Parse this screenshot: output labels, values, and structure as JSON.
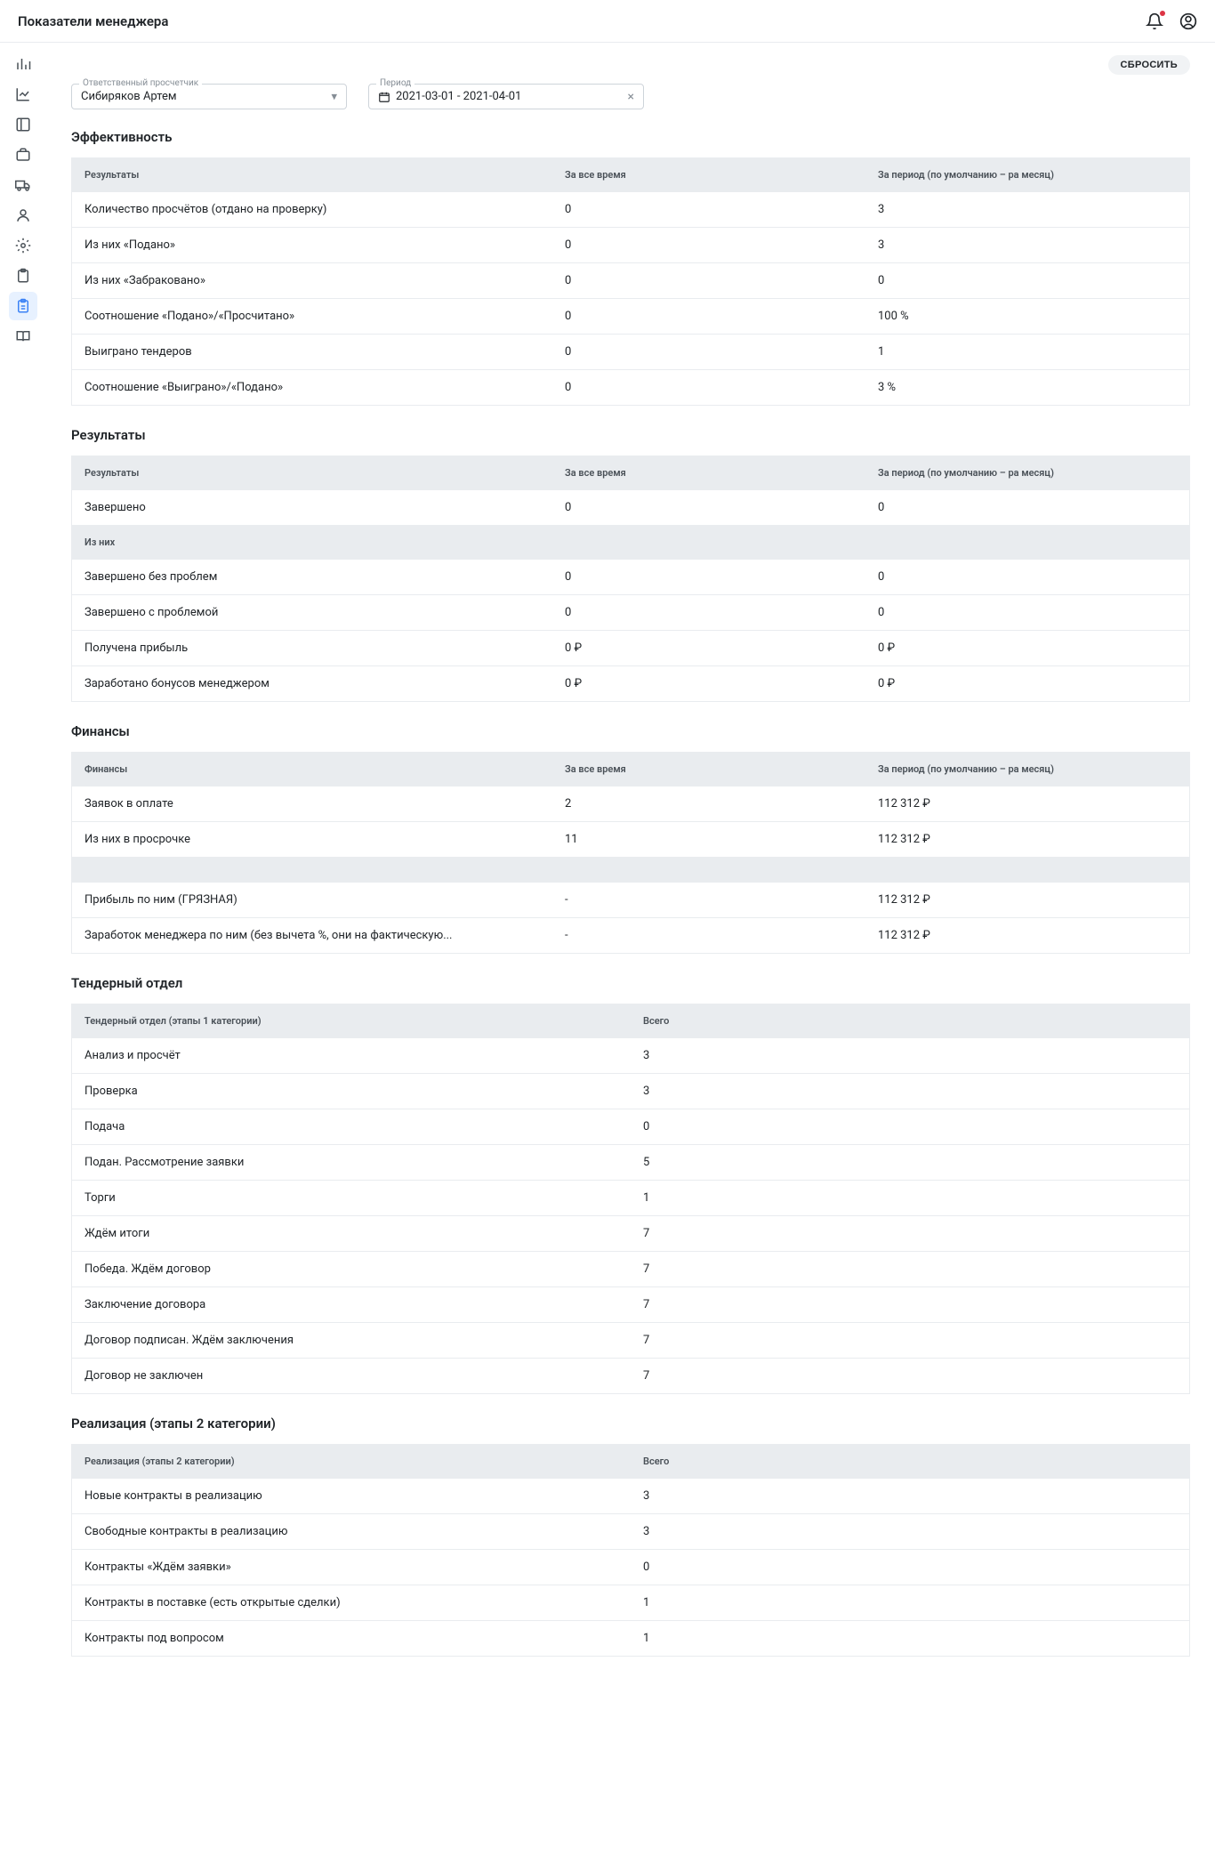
{
  "header": {
    "title": "Показатели менеджера"
  },
  "top": {
    "reset": "СБРОСИТЬ"
  },
  "filters": {
    "responsible": {
      "label": "Ответственный просчетчик",
      "value": "Сибиряков Артем"
    },
    "period": {
      "label": "Период",
      "value": "2021-03-01 - 2021-04-01"
    }
  },
  "cols3": {
    "results": "Результаты",
    "all": "За все время",
    "period": "За период (по умолчанию – ра месяц)"
  },
  "sections": {
    "eff": {
      "title": "Эффективность",
      "rows": [
        {
          "name": "Количество просчётов (отдано на проверку)",
          "all": "0",
          "period": "3"
        },
        {
          "name": "Из них «Подано»",
          "all": "0",
          "period": "3"
        },
        {
          "name": "Из них «Забраковано»",
          "all": "0",
          "period": "0"
        },
        {
          "name": "Соотношение «Подано»/«Просчитано»",
          "all": "0",
          "period": "100 %"
        },
        {
          "name": "Выиграно тендеров",
          "all": "0",
          "period": "1"
        },
        {
          "name": "Соотношение «Выиграно»/«Подано»",
          "all": "0",
          "period": "3 %"
        }
      ]
    },
    "res": {
      "title": "Результаты",
      "rows1": [
        {
          "name": "Завершено",
          "all": "0",
          "period": "0"
        }
      ],
      "sub": "Из них",
      "rows2": [
        {
          "name": "Завершено без проблем",
          "all": "0",
          "period": "0"
        },
        {
          "name": "Завершено с проблемой",
          "all": "0",
          "period": "0"
        },
        {
          "name": "Получена прибыль",
          "all": "0 ₽",
          "period": "0 ₽"
        },
        {
          "name": "Заработано бонусов менеджером",
          "all": "0 ₽",
          "period": "0 ₽"
        }
      ]
    },
    "fin": {
      "title": "Финансы",
      "head": "Финансы",
      "rows1": [
        {
          "name": "Заявок в оплате",
          "all": "2",
          "period": "112 312 ₽"
        },
        {
          "name": "Из них в просрочке",
          "all": "11",
          "period": "112 312 ₽"
        }
      ],
      "rows2": [
        {
          "name": "Прибыль по ним (ГРЯЗНАЯ)",
          "all": "-",
          "period": "112 312 ₽"
        },
        {
          "name": "Заработок менеджера по ним (без вычета %, они на фактическую...",
          "all": "-",
          "period": "112 312 ₽"
        }
      ]
    },
    "tender": {
      "title": "Тендерный отдел",
      "cols": {
        "name": "Тендерный отдел (этапы 1 категории)",
        "total": "Всего"
      },
      "rows": [
        {
          "name": "Анализ и просчёт",
          "total": "3"
        },
        {
          "name": "Проверка",
          "total": "3"
        },
        {
          "name": "Подача",
          "total": "0"
        },
        {
          "name": "Подан. Рассмотрение заявки",
          "total": "5"
        },
        {
          "name": "Торги",
          "total": "1"
        },
        {
          "name": "Ждём итоги",
          "total": "7"
        },
        {
          "name": "Победа. Ждём договор",
          "total": "7"
        },
        {
          "name": "Заключение договора",
          "total": "7"
        },
        {
          "name": "Договор подписан. Ждём заключения",
          "total": "7"
        },
        {
          "name": "Договор не заключен",
          "total": "7"
        }
      ]
    },
    "real": {
      "title": "Реализация (этапы 2 категории)",
      "cols": {
        "name": "Реализация (этапы 2 категории)",
        "total": "Всего"
      },
      "rows": [
        {
          "name": "Новые контракты в реализацию",
          "total": "3"
        },
        {
          "name": "Свободные контракты в реализацию",
          "total": "3"
        },
        {
          "name": "Контракты «Ждём заявки»",
          "total": "0"
        },
        {
          "name": "Контракты в поставке (есть открытые сделки)",
          "total": "1"
        },
        {
          "name": "Контракты под вопросом",
          "total": "1"
        }
      ]
    }
  }
}
